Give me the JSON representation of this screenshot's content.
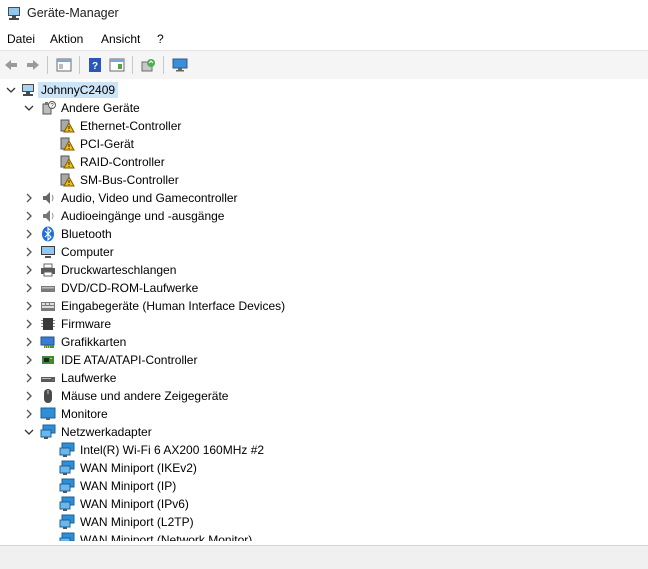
{
  "window": {
    "title": "Geräte-Manager"
  },
  "menu": {
    "items": [
      "Datei",
      "Aktion",
      "Ansicht",
      "?"
    ]
  },
  "tree": {
    "root": "JohnnyC2409",
    "other_devices": {
      "label": "Andere Geräte",
      "children": [
        "Ethernet-Controller",
        "PCI-Gerät",
        "RAID-Controller",
        "SM-Bus-Controller"
      ]
    },
    "categories": [
      "Audio, Video und Gamecontroller",
      "Audioeingänge und -ausgänge",
      "Bluetooth",
      "Computer",
      "Druckwarteschlangen",
      "DVD/CD-ROM-Laufwerke",
      "Eingabegeräte (Human Interface Devices)",
      "Firmware",
      "Grafikkarten",
      "IDE ATA/ATAPI-Controller",
      "Laufwerke",
      "Mäuse und andere Zeigegeräte",
      "Monitore"
    ],
    "network": {
      "label": "Netzwerkadapter",
      "children": [
        "Intel(R) Wi-Fi 6 AX200 160MHz #2",
        "WAN Miniport (IKEv2)",
        "WAN Miniport (IP)",
        "WAN Miniport (IPv6)",
        "WAN Miniport (L2TP)",
        "WAN Miniport (Network Monitor)"
      ]
    }
  },
  "icons": {
    "categories": [
      "speaker-icon",
      "speaker-icon",
      "bluetooth-icon",
      "computer-icon",
      "printer-icon",
      "dvd-drive-icon",
      "hid-icon",
      "chip-icon",
      "display-adapter-icon",
      "ide-controller-icon",
      "drive-icon",
      "mouse-icon",
      "monitor-icon"
    ]
  },
  "colors": {
    "selection": "#cce4f7",
    "warning": "#f5c000",
    "network": "#2e8fd6"
  }
}
